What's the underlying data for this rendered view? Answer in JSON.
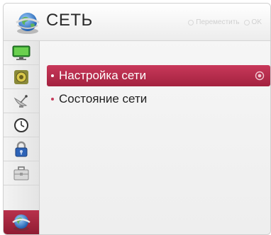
{
  "header": {
    "title": "СЕТЬ",
    "icon": "network-globe-icon",
    "hint_move": "Переместить",
    "hint_ok": "OK"
  },
  "sidebar": {
    "items": [
      {
        "icon": "picture-tv-icon"
      },
      {
        "icon": "audio-speaker-icon"
      },
      {
        "icon": "satellite-dish-icon"
      },
      {
        "icon": "clock-icon"
      },
      {
        "icon": "lock-icon"
      },
      {
        "icon": "options-toolbox-icon"
      },
      {
        "icon": "network-globe-icon",
        "active": true
      }
    ]
  },
  "menu": {
    "items": [
      {
        "label": "Настройка сети",
        "selected": true
      },
      {
        "label": "Состояние сети",
        "selected": false
      }
    ]
  },
  "colors": {
    "accent": "#b32a47",
    "background": "#f2f2f2",
    "text": "#222222"
  }
}
